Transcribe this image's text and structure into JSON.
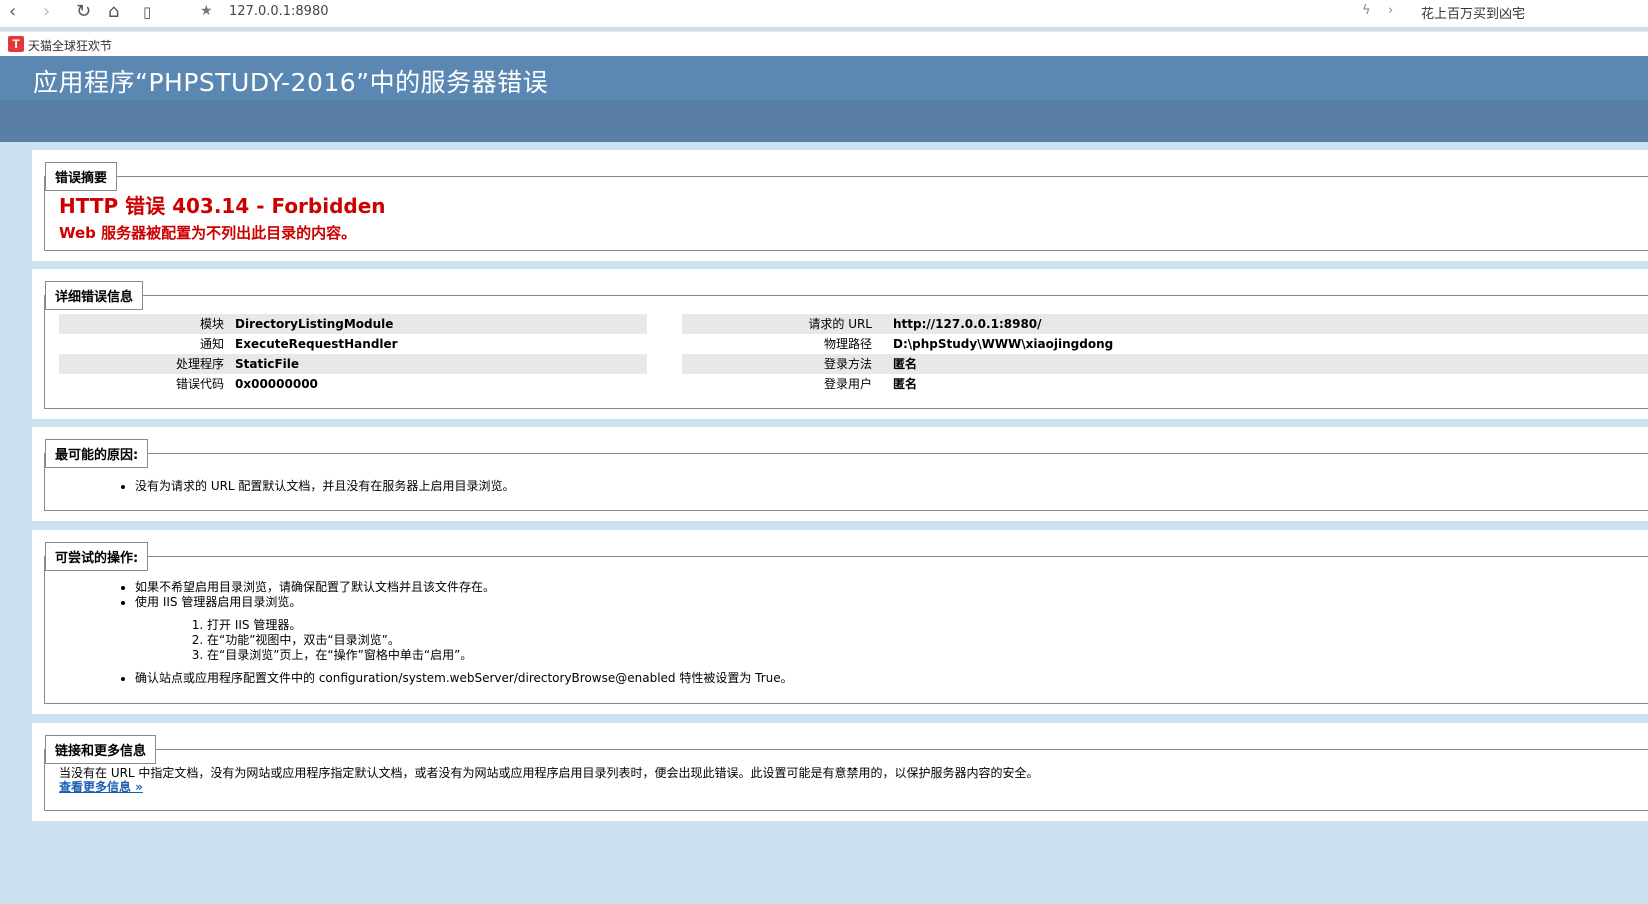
{
  "browser": {
    "address": "127.0.0.1:8980",
    "right_text": "花上百万买到凶宅",
    "bookmark_logo": "T",
    "bookmark_label": "天猫全球狂欢节"
  },
  "header": {
    "title": "应用程序“PHPSTUDY-2016”中的服务器错误"
  },
  "summary": {
    "legend": "错误摘要",
    "title": "HTTP 错误 403.14 - Forbidden",
    "subtitle": "Web 服务器被配置为不列出此目录的内容。"
  },
  "details": {
    "legend": "详细错误信息",
    "left": [
      {
        "label": "模块",
        "value": "DirectoryListingModule"
      },
      {
        "label": "通知",
        "value": "ExecuteRequestHandler"
      },
      {
        "label": "处理程序",
        "value": "StaticFile"
      },
      {
        "label": "错误代码",
        "value": "0x00000000"
      }
    ],
    "right": [
      {
        "label": "请求的 URL",
        "value": "http://127.0.0.1:8980/"
      },
      {
        "label": "物理路径",
        "value": "D:\\phpStudy\\WWW\\xiaojingdong"
      },
      {
        "label": "登录方法",
        "value": "匿名"
      },
      {
        "label": "登录用户",
        "value": "匿名"
      }
    ]
  },
  "causes": {
    "legend": "最可能的原因:",
    "items": [
      "没有为请求的 URL 配置默认文档，并且没有在服务器上启用目录浏览。"
    ]
  },
  "actions": {
    "legend": "可尝试的操作:",
    "item1": "如果不希望启用目录浏览，请确保配置了默认文档并且该文件存在。",
    "item2": "使用 IIS 管理器启用目录浏览。",
    "steps": [
      "打开 IIS 管理器。",
      "在“功能”视图中，双击“目录浏览”。",
      "在“目录浏览”页上，在“操作”窗格中单击“启用”。"
    ],
    "item3": "确认站点或应用程序配置文件中的 configuration/system.webServer/directoryBrowse@enabled 特性被设置为 True。"
  },
  "links": {
    "legend": "链接和更多信息",
    "text": "当没有在 URL 中指定文档，没有为网站或应用程序指定默认文档，或者没有为网站或应用程序启用目录列表时，便会出现此错误。此设置可能是有意禁用的，以保护服务器内容的安全。",
    "more": "查看更多信息 »"
  }
}
